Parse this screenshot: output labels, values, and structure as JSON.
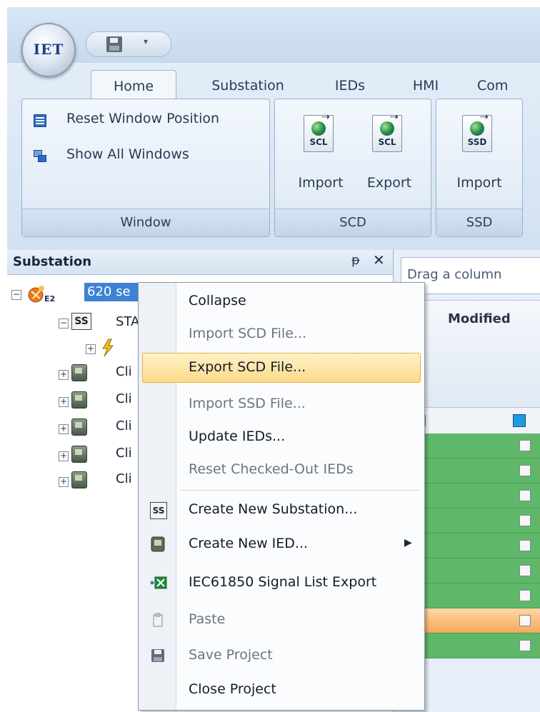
{
  "app": {
    "orb_label": "IET"
  },
  "ribbon": {
    "tabs": [
      {
        "label": "Home",
        "active": true
      },
      {
        "label": "Substation"
      },
      {
        "label": "IEDs"
      },
      {
        "label": "HMI"
      },
      {
        "label": "Com"
      }
    ],
    "groups": {
      "window": {
        "label": "Window",
        "commands": [
          "Reset Window Position",
          "Show All Windows"
        ]
      },
      "scd": {
        "label": "SCD",
        "buttons": [
          {
            "label": "Import",
            "tag": "SCL"
          },
          {
            "label": "Export",
            "tag": "SCL"
          }
        ]
      },
      "ssd": {
        "label": "SSD",
        "buttons": [
          {
            "label": "Import",
            "tag": "SSD"
          }
        ]
      }
    }
  },
  "panel": {
    "title": "Substation",
    "pin_glyph": "ᵽ",
    "close_glyph": "✕",
    "tree": {
      "root": {
        "label": "620 se",
        "badge": "E2"
      },
      "station": {
        "badge": "SS",
        "label": "STA"
      },
      "ied_label": "Cli"
    }
  },
  "grid": {
    "group_hint": "Drag a column",
    "column_header": "Modified",
    "row_count": 9
  },
  "context_menu": {
    "items": [
      {
        "label": "Collapse",
        "state": "enabled"
      },
      {
        "label": "Import SCD File...",
        "state": "disabled"
      },
      {
        "label": "Export SCD File...",
        "state": "highlighted"
      },
      {
        "label": "Import SSD File...",
        "state": "disabled"
      },
      {
        "label": "Update IEDs...",
        "state": "enabled"
      },
      {
        "label": "Reset Checked-Out IEDs",
        "state": "disabled"
      },
      {
        "label": "Create New Substation...",
        "state": "enabled",
        "icon": "ss-icon",
        "icon_text": "SS"
      },
      {
        "label": "Create New IED...",
        "state": "enabled",
        "icon": "ied-icon",
        "has_submenu": true
      },
      {
        "label": "IEC61850 Signal List Export",
        "state": "enabled",
        "icon": "excel-export-icon"
      },
      {
        "label": "Paste",
        "state": "disabled",
        "icon": "clipboard-icon"
      },
      {
        "label": "Save Project",
        "state": "disabled",
        "icon": "save-icon"
      },
      {
        "label": "Close Project",
        "state": "enabled"
      }
    ]
  }
}
